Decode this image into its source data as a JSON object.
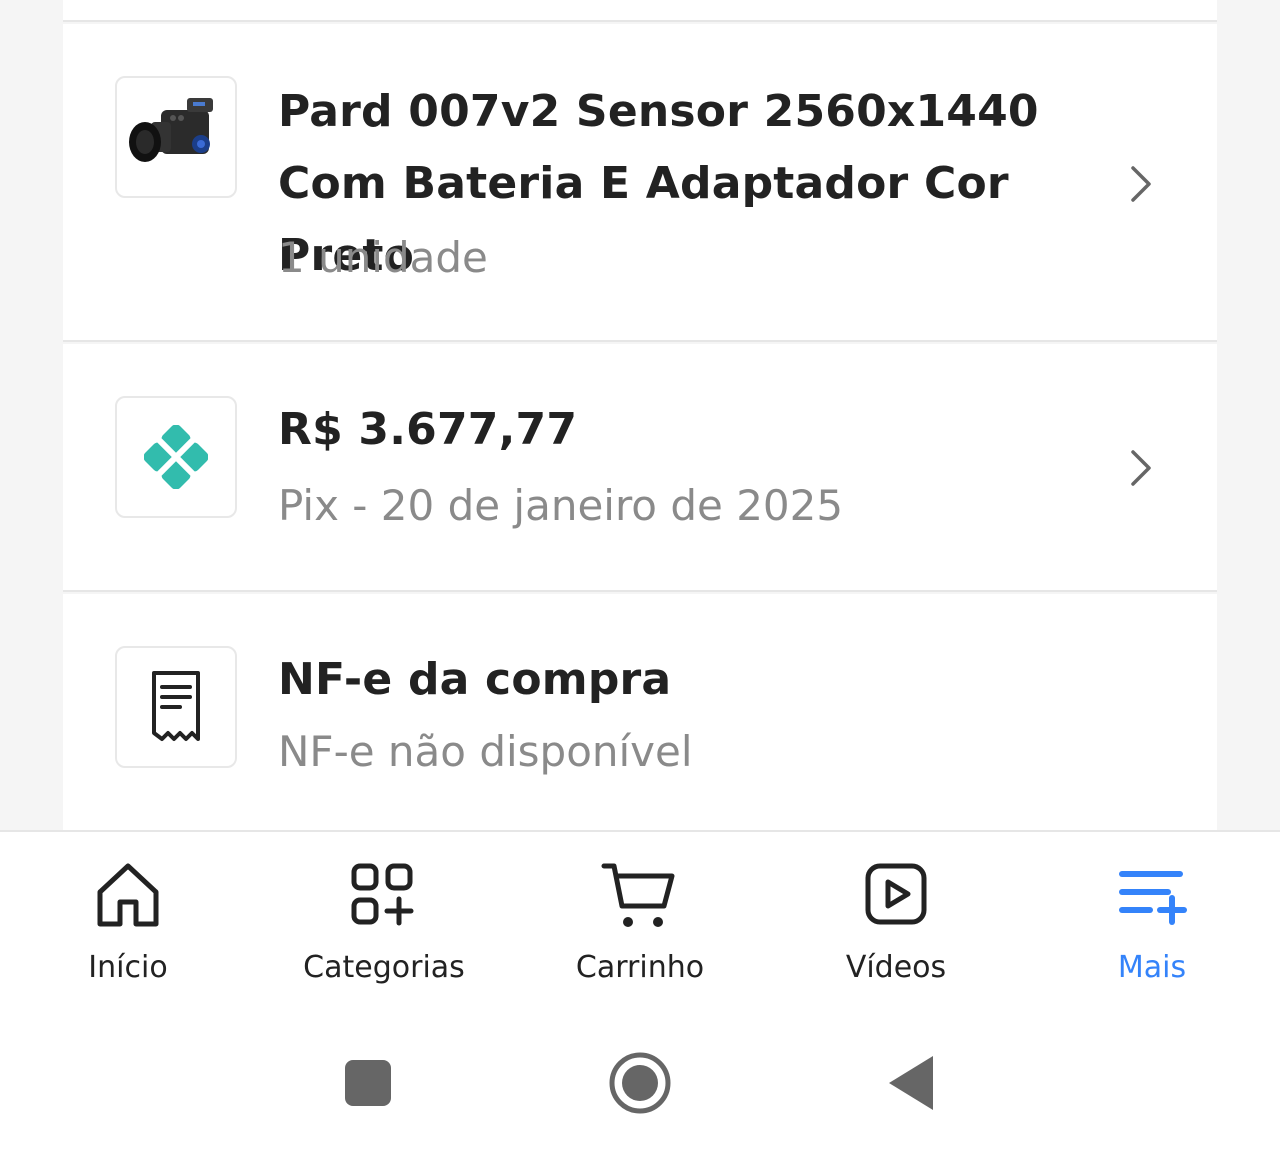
{
  "order_items": {
    "product": {
      "title": "Pard 007v2 Sensor 2560x1440 Com Bateria E Adaptador Cor Preto",
      "quantity": "1 unidade",
      "image_icon": "night-vision-camera-icon"
    },
    "payment": {
      "amount": "R$ 3.677,77",
      "details": "Pix - 20 de janeiro de 2025",
      "icon": "pix-icon",
      "icon_color": "#32bcad"
    },
    "nfe": {
      "title": "NF-e da compra",
      "status": "NF-e não disponível",
      "icon": "receipt-icon"
    }
  },
  "bottom_nav": {
    "items": [
      {
        "label": "Início",
        "icon": "home-icon"
      },
      {
        "label": "Categorias",
        "icon": "categories-icon"
      },
      {
        "label": "Carrinho",
        "icon": "cart-icon"
      },
      {
        "label": "Vídeos",
        "icon": "video-icon"
      },
      {
        "label": "Mais",
        "icon": "more-menu-icon",
        "active": true
      }
    ],
    "active_color": "#3483fa"
  },
  "system_nav": {
    "buttons": [
      "recents-button",
      "home-button",
      "back-button"
    ]
  }
}
